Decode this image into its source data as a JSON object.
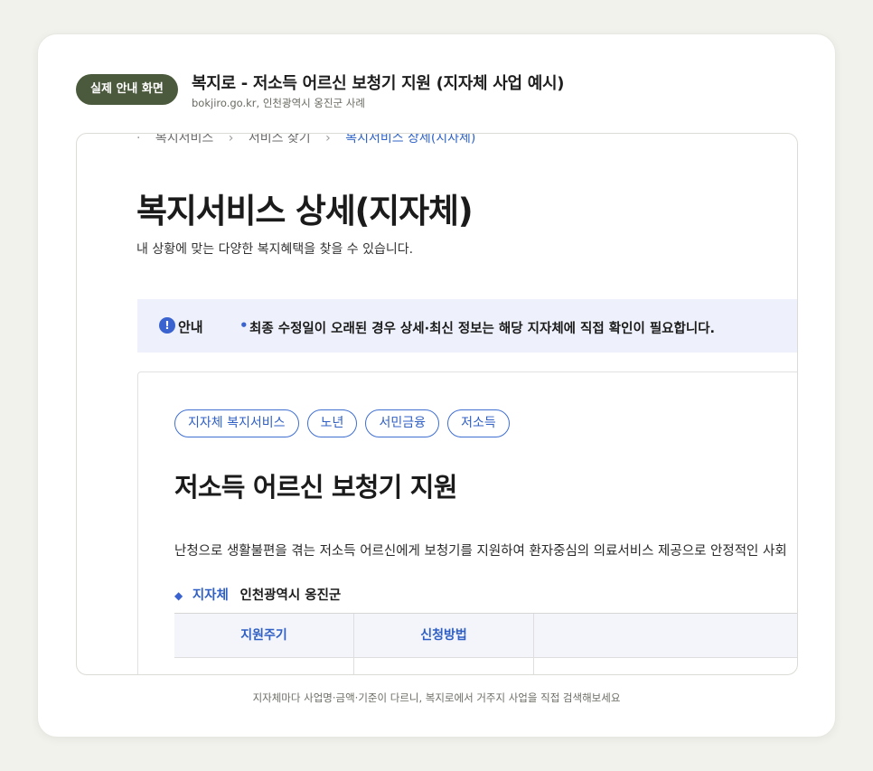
{
  "header": {
    "badge": "실제 안내 화면",
    "title": "복지로 - 저소득 어르신 보청기 지원 (지자체 사업 예시)",
    "subtitle": "bokjiro.go.kr, 인천광역시 옹진군 사례"
  },
  "screenshot": {
    "breadcrumb": [
      "복지서비스",
      "서비스 찾기",
      "복지서비스 상세(지자체)"
    ],
    "page_title": "복지서비스 상세(지자체)",
    "page_desc": "내 상황에 맞는 다양한 복지혜택을 찾을 수 있습니다.",
    "notice": {
      "label": "안내",
      "text": "최종 수정일이 오래된 경우 상세·최신 정보는 해당 지자체에 직접 확인이 필요합니다."
    },
    "tags": [
      "지자체 복지서비스",
      "노년",
      "서민금융",
      "저소득"
    ],
    "service_title": "저소득 어르신 보청기 지원",
    "service_desc": "난청으로 생활불편을 겪는 저소득 어르신에게 보청기를 지원하여 환자중심의 의료서비스 제공으로 안정적인 사회",
    "region": {
      "label": "지자체",
      "value": "인천광역시 옹진군"
    },
    "table_headers": [
      "지원주기",
      "신청방법",
      ""
    ]
  },
  "caption": "지자체마다 사업명·금액·기준이 다르니, 복지로에서 거주지 사업을 직접 검색해보세요",
  "colors": {
    "badge_bg": "#4b5a3c",
    "accent_blue": "#2f5fc4",
    "notice_bg": "#eef1fb"
  }
}
